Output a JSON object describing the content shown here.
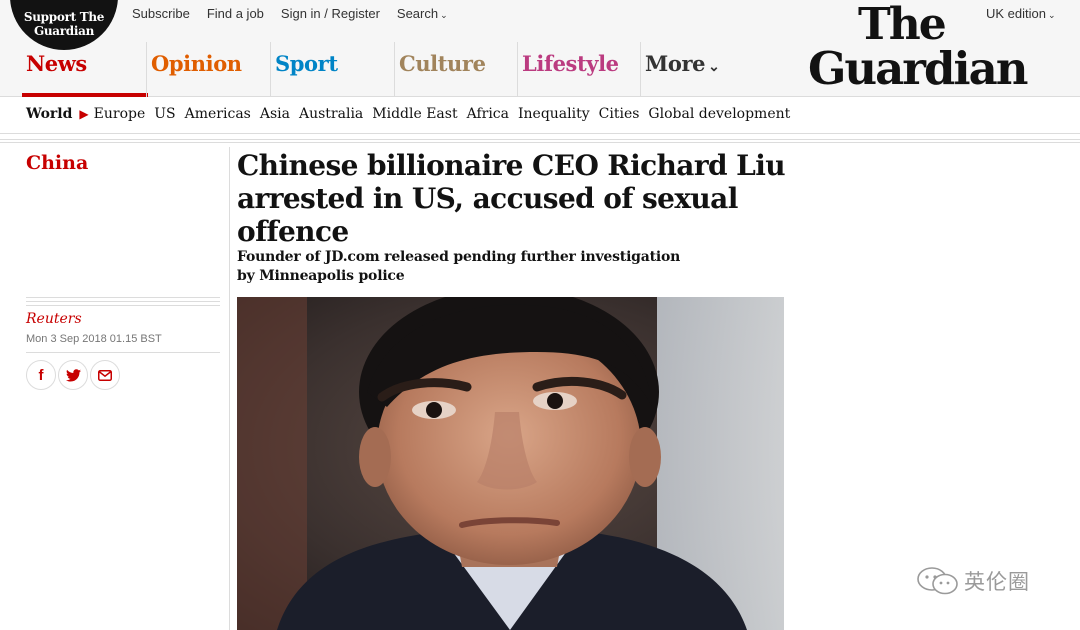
{
  "support": {
    "line1": "Support The",
    "line2": "Guardian"
  },
  "top_links": [
    "Subscribe",
    "Find a job",
    "Sign in / Register",
    "Search"
  ],
  "edition": "UK edition",
  "logo": {
    "line1": "The",
    "line2": "Guardian"
  },
  "pillars": [
    {
      "label": "News",
      "color": "#c70000"
    },
    {
      "label": "Opinion",
      "color": "#e05e00"
    },
    {
      "label": "Sport",
      "color": "#0084c6"
    },
    {
      "label": "Culture",
      "color": "#a1845c"
    },
    {
      "label": "Lifestyle",
      "color": "#bb3b80"
    },
    {
      "label": "More",
      "color": "#333333"
    }
  ],
  "subnav": {
    "current": "World",
    "items": [
      "Europe",
      "US",
      "Americas",
      "Asia",
      "Australia",
      "Middle East",
      "Africa",
      "Inequality",
      "Cities",
      "Global development"
    ]
  },
  "article": {
    "section": "China",
    "byline": "Reuters",
    "date": "Mon 3 Sep 2018 01.15 BST",
    "headline": "Chinese billionaire CEO Richard Liu arrested in US, accused of sexual offence",
    "standfirst": "Founder of JD.com released pending further investigation by Minneapolis police",
    "share_icons": [
      "facebook-icon",
      "twitter-icon",
      "email-icon"
    ]
  },
  "watermark": "英伦圈"
}
